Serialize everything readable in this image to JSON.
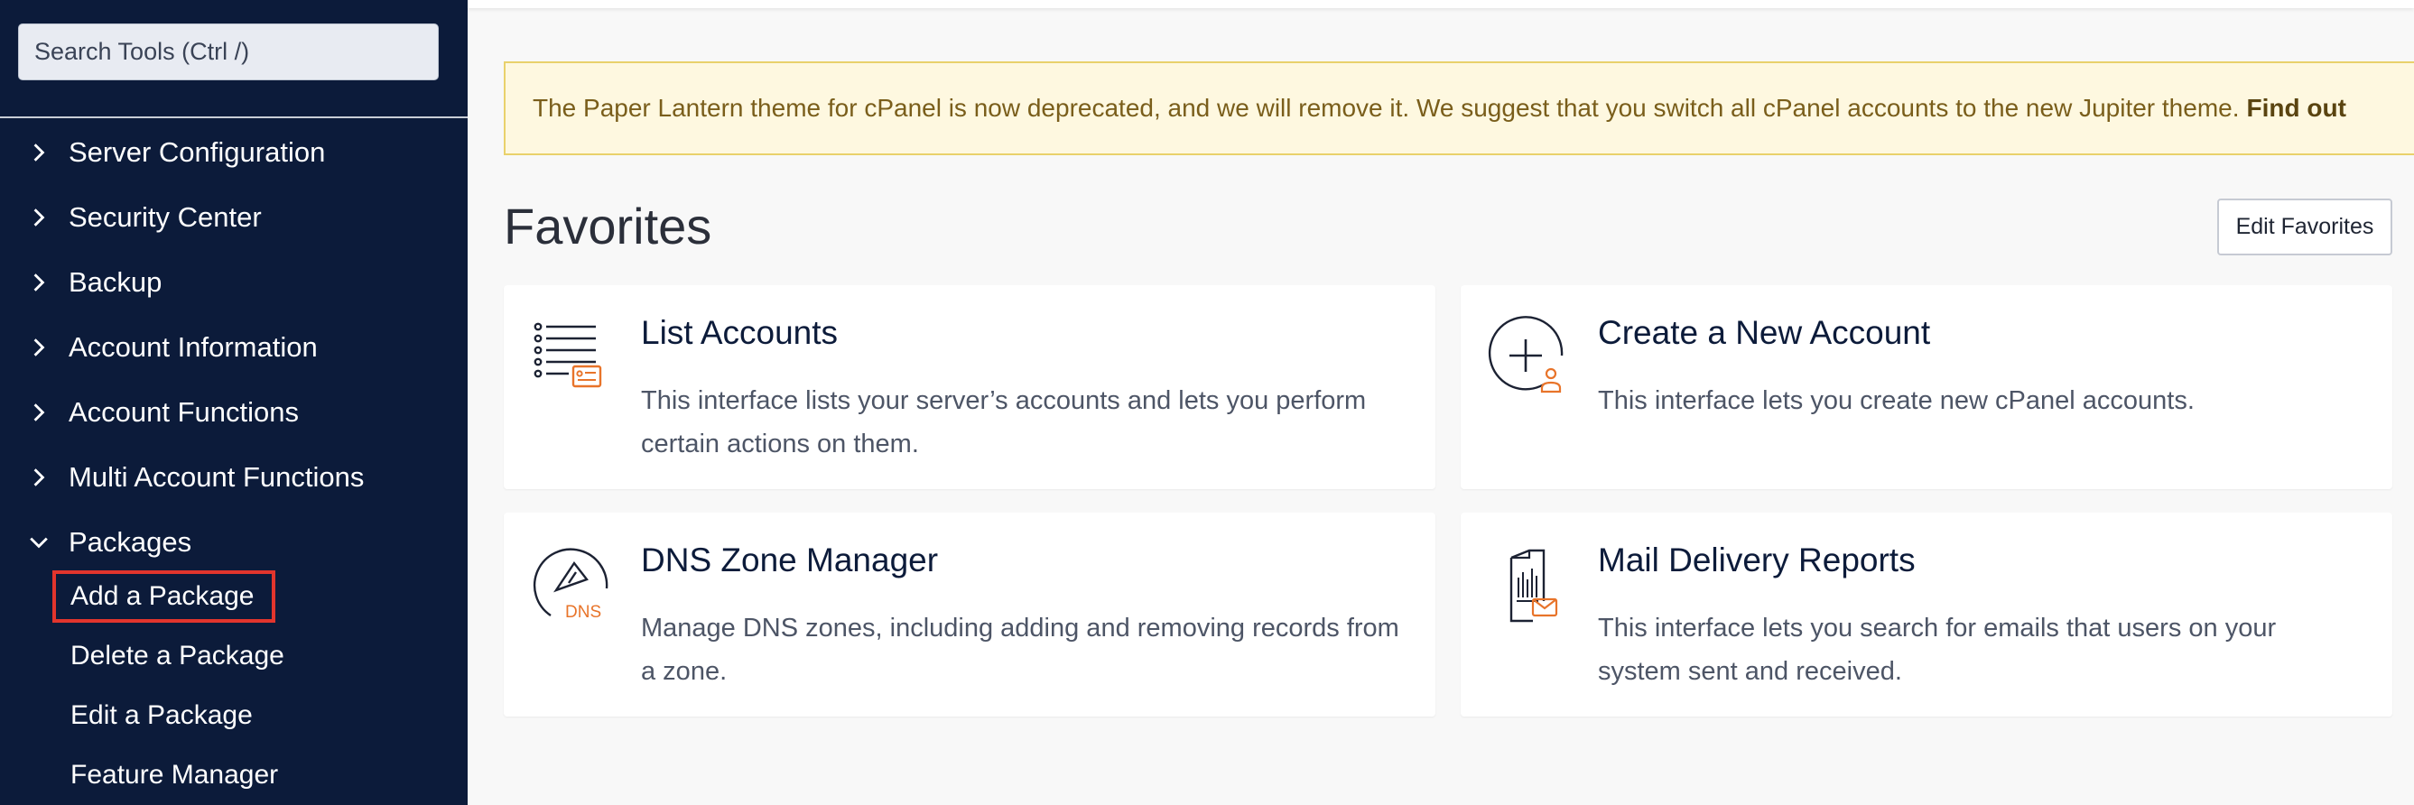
{
  "search": {
    "placeholder": "Search Tools (Ctrl /)"
  },
  "sidebar": {
    "items": [
      {
        "label": "Server Configuration"
      },
      {
        "label": "Security Center"
      },
      {
        "label": "Backup"
      },
      {
        "label": "Account Information"
      },
      {
        "label": "Account Functions"
      },
      {
        "label": "Multi Account Functions"
      },
      {
        "label": "Packages"
      }
    ],
    "packages_sub": [
      {
        "label": "Add a Package"
      },
      {
        "label": "Delete a Package"
      },
      {
        "label": "Edit a Package"
      },
      {
        "label": "Feature Manager"
      }
    ]
  },
  "notice": {
    "text": "The Paper Lantern theme for cPanel is now deprecated, and we will remove it. We suggest that you switch all cPanel accounts to the new Jupiter theme.",
    "link": "Find out"
  },
  "favorites": {
    "title": "Favorites",
    "edit_label": "Edit Favorites",
    "cards": [
      {
        "title": "List Accounts",
        "desc": "This interface lists your server’s accounts and lets you perform certain actions on them.",
        "icon": "list-accounts-icon"
      },
      {
        "title": "Create a New Account",
        "desc": "This interface lets you create new cPanel accounts.",
        "icon": "create-account-icon"
      },
      {
        "title": "DNS Zone Manager",
        "desc": "Manage DNS zones, including adding and removing records from a zone.",
        "icon": "dns-icon",
        "icon_text": "DNS"
      },
      {
        "title": "Mail Delivery Reports",
        "desc": "This interface lets you search for emails that users on your system sent and received.",
        "icon": "mail-report-icon"
      }
    ]
  },
  "colors": {
    "sidebar_bg": "#0c1b3a",
    "accent_orange": "#e8742a",
    "selected_outline": "#e2352d",
    "notice_bg": "#fef8e0"
  }
}
